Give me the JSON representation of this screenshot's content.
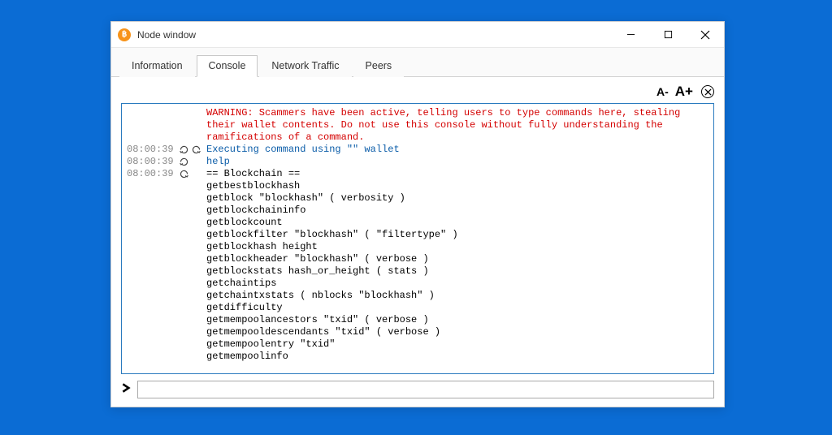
{
  "window": {
    "title": "Node window"
  },
  "tabs": [
    {
      "label": "Information",
      "active": false
    },
    {
      "label": "Console",
      "active": true
    },
    {
      "label": "Network Traffic",
      "active": false
    },
    {
      "label": "Peers",
      "active": false
    }
  ],
  "toolbar": {
    "font_decrease": "A-",
    "font_increase": "A+"
  },
  "console": {
    "warning": "WARNING: Scammers have been active, telling users to type commands here, stealing their wallet contents. Do not use this console without fully understanding the ramifications of a command.",
    "rows": [
      {
        "ts": "08:00:39",
        "kind": "info",
        "text": "Executing command using \"\" wallet"
      },
      {
        "ts": "08:00:39",
        "kind": "sent",
        "text": "help"
      },
      {
        "ts": "08:00:39",
        "kind": "recv",
        "text": "== Blockchain ==\ngetbestblockhash\ngetblock \"blockhash\" ( verbosity )\ngetblockchaininfo\ngetblockcount\ngetblockfilter \"blockhash\" ( \"filtertype\" )\ngetblockhash height\ngetblockheader \"blockhash\" ( verbose )\ngetblockstats hash_or_height ( stats )\ngetchaintips\ngetchaintxstats ( nblocks \"blockhash\" )\ngetdifficulty\ngetmempoolancestors \"txid\" ( verbose )\ngetmempooldescendants \"txid\" ( verbose )\ngetmempoolentry \"txid\"\ngetmempoolinfo"
      }
    ]
  },
  "input": {
    "placeholder": ""
  }
}
